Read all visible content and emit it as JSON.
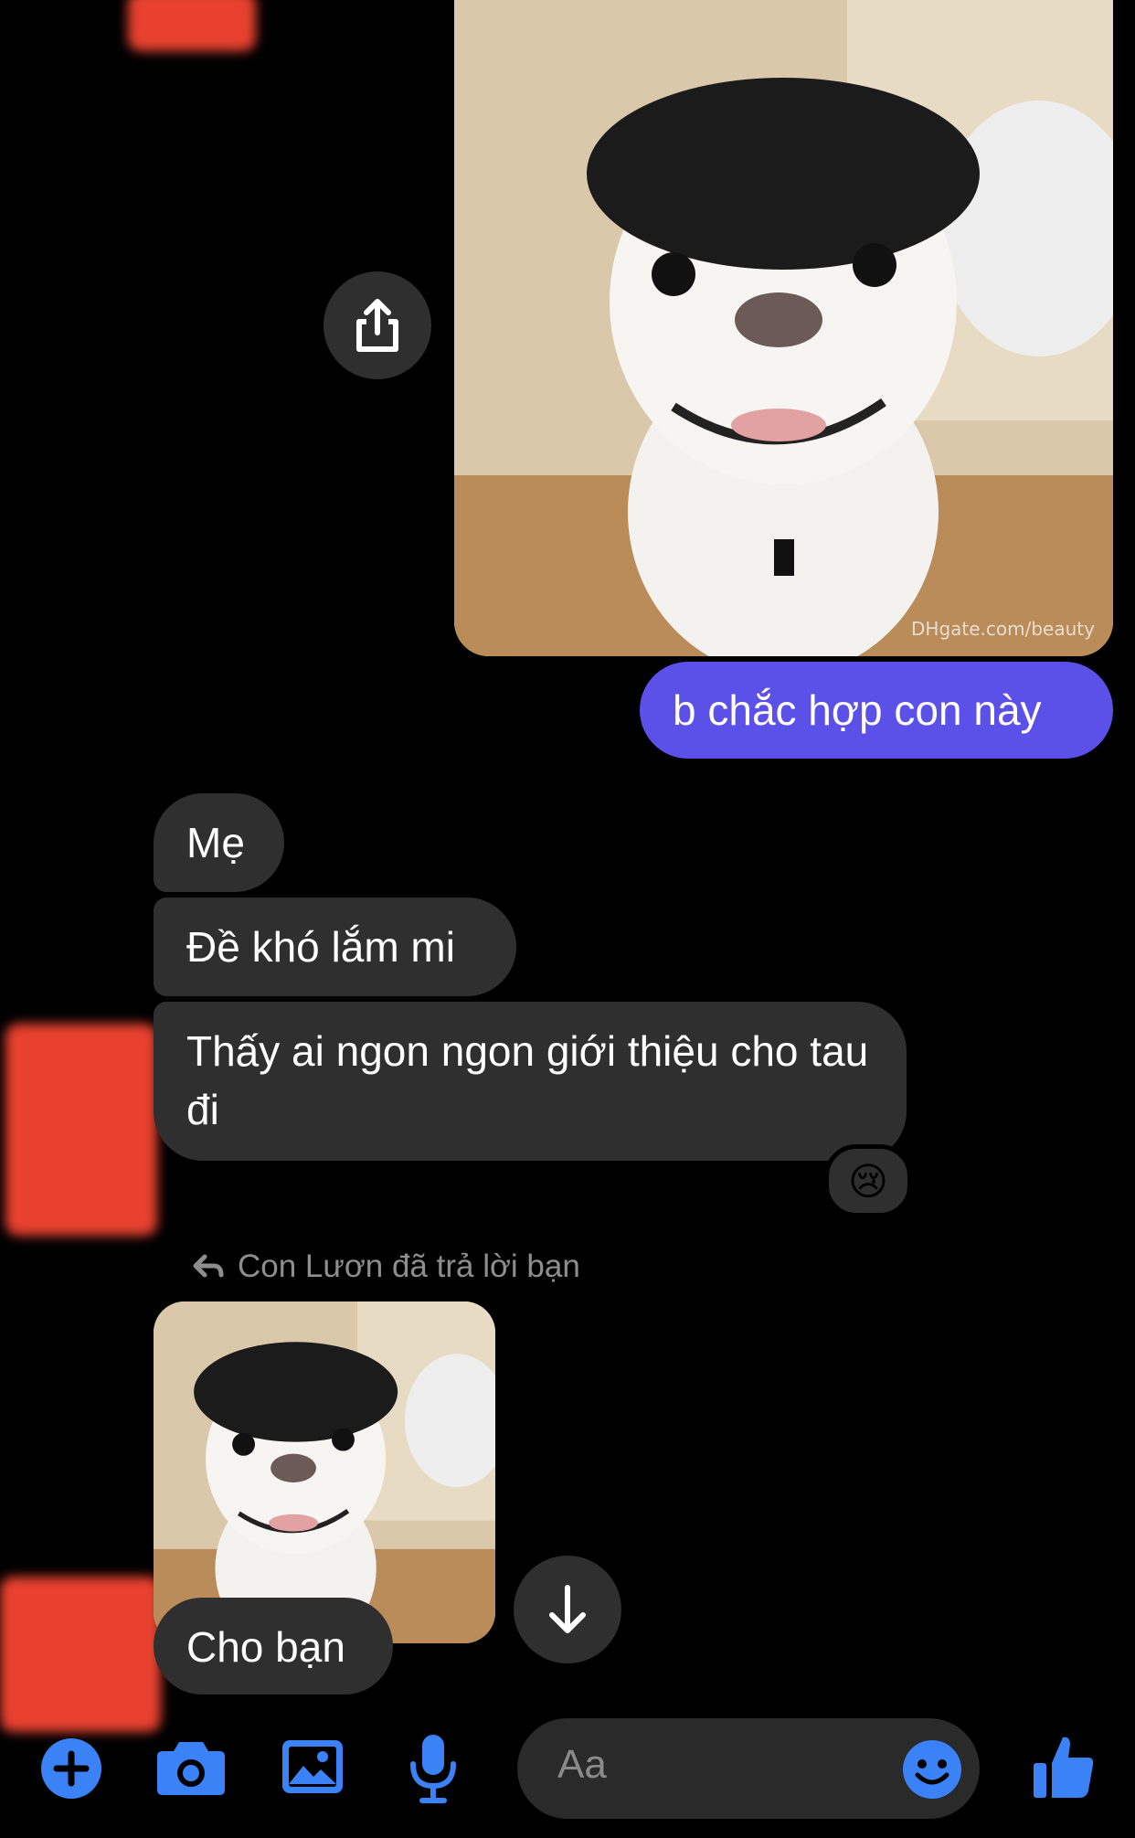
{
  "messages": {
    "outgoing_text": "b chắc hợp con này",
    "incoming": [
      "Mẹ",
      "Đề khó lắm mi",
      "Thấy ai ngon ngon giới thiệu cho tau đi"
    ],
    "reaction_emoji": "😢",
    "reply_note": "Con Lươn đã trả lời bạn",
    "reply_text": "Cho bạn",
    "photo_watermark": "DHgate.com/beauty"
  },
  "composer": {
    "placeholder": "Aa"
  },
  "colors": {
    "background": "#000000",
    "outgoing_bubble": "#5b51e8",
    "incoming_bubble": "#2f2f2f",
    "accent": "#3b82f6",
    "redaction": "#e8412f"
  },
  "icons": [
    "share-icon",
    "arrow-down-icon",
    "plus-icon",
    "camera-icon",
    "gallery-icon",
    "microphone-icon",
    "emoji-icon",
    "thumbs-up-icon",
    "reply-arrow-icon"
  ]
}
